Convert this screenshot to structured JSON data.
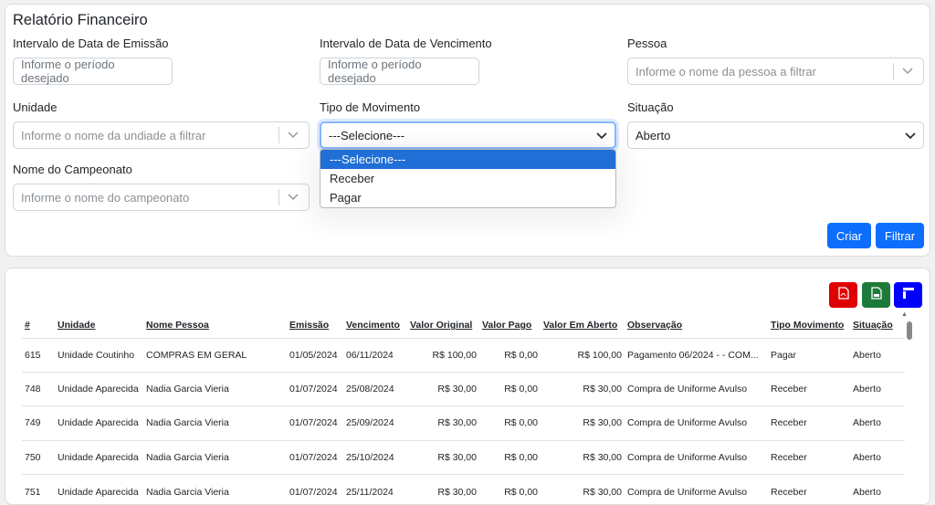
{
  "page": {
    "title": "Relatório Financeiro"
  },
  "filters": {
    "emissao": {
      "label": "Intervalo de Data de Emissão",
      "placeholder": "Informe o período desejado"
    },
    "vencimento": {
      "label": "Intervalo de Data de Vencimento",
      "placeholder": "Informe o período desejado"
    },
    "pessoa": {
      "label": "Pessoa",
      "placeholder": "Informe o nome da pessoa a filtrar"
    },
    "unidade": {
      "label": "Unidade",
      "placeholder": "Informe o nome da undiade a filtrar"
    },
    "tipo": {
      "label": "Tipo de Movimento",
      "value": "---Selecione---",
      "options": [
        "---Selecione---",
        "Receber",
        "Pagar"
      ]
    },
    "situacao": {
      "label": "Situação",
      "value": "Aberto"
    },
    "campeonato": {
      "label": "Nome do Campeonato",
      "placeholder": "Informe o nome do campeonato"
    }
  },
  "buttons": {
    "criar": "Criar",
    "filtrar": "Filtrar"
  },
  "exports": [
    {
      "icon": "pdf-icon",
      "color": "#e00000"
    },
    {
      "icon": "excel-icon",
      "color": "#1e7a3a"
    },
    {
      "icon": "layout-icon",
      "color": "#0000ff"
    }
  ],
  "table": {
    "headers": [
      "#",
      "Unidade",
      "Nome Pessoa",
      "Emissão",
      "Vencimento",
      "Valor Original",
      "Valor Pago",
      "Valor Em Aberto",
      "Observação",
      "Tipo Movimento",
      "Situação"
    ],
    "rows": [
      [
        "615",
        "Unidade Coutinho",
        "COMPRAS EM GERAL",
        "01/05/2024",
        "06/11/2024",
        "R$ 100,00",
        "R$ 0,00",
        "R$ 100,00",
        "Pagamento 06/2024 - - COM...",
        "Pagar",
        "Aberto"
      ],
      [
        "748",
        "Unidade Aparecida",
        "Nadia Garcia Vieria",
        "01/07/2024",
        "25/08/2024",
        "R$ 30,00",
        "R$ 0,00",
        "R$ 30,00",
        "Compra de Uniforme Avulso",
        "Receber",
        "Aberto"
      ],
      [
        "749",
        "Unidade Aparecida",
        "Nadia Garcia Vieria",
        "01/07/2024",
        "25/09/2024",
        "R$ 30,00",
        "R$ 0,00",
        "R$ 30,00",
        "Compra de Uniforme Avulso",
        "Receber",
        "Aberto"
      ],
      [
        "750",
        "Unidade Aparecida",
        "Nadia Garcia Vieria",
        "01/07/2024",
        "25/10/2024",
        "R$ 30,00",
        "R$ 0,00",
        "R$ 30,00",
        "Compra de Uniforme Avulso",
        "Receber",
        "Aberto"
      ],
      [
        "751",
        "Unidade Aparecida",
        "Nadia Garcia Vieria",
        "01/07/2024",
        "25/11/2024",
        "R$ 30,00",
        "R$ 0,00",
        "R$ 30,00",
        "Compra de Uniforme Avulso",
        "Receber",
        "Aberto"
      ]
    ]
  }
}
